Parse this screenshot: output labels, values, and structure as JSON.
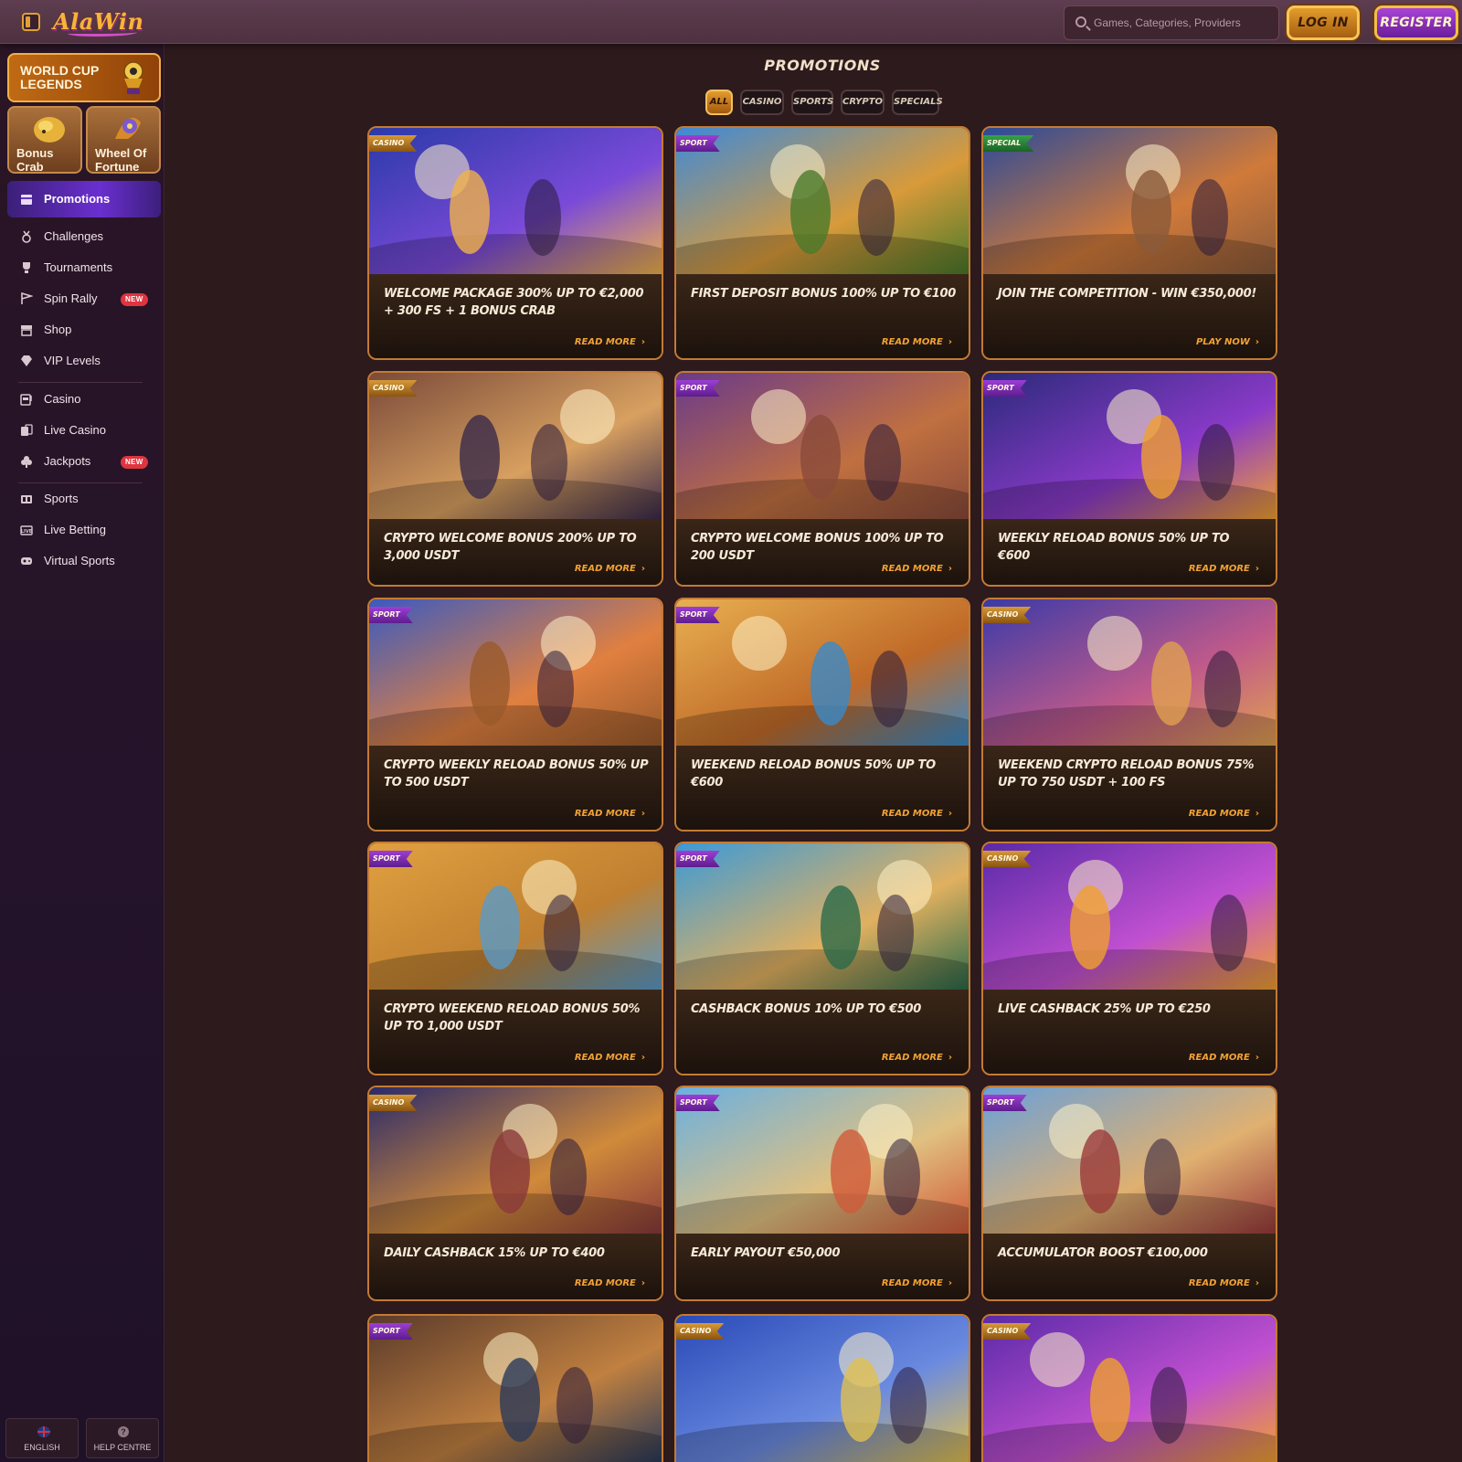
{
  "header": {
    "logo_text": "AlaWin",
    "search_placeholder": "Games, Categories, Providers",
    "login_label": "LOG IN",
    "register_label": "REGISTER"
  },
  "sidebar": {
    "banner_label": "WORLD CUP LEGENDS",
    "tiles": [
      {
        "label_line1": "Bonus",
        "label_line2": "Crab"
      },
      {
        "label_line1": "Wheel Of",
        "label_line2": "Fortune"
      }
    ],
    "items": [
      {
        "label": "Promotions",
        "icon": "gift-box-icon"
      },
      {
        "label": "Challenges",
        "icon": "medal-icon"
      },
      {
        "label": "Tournaments",
        "icon": "trophy-icon"
      },
      {
        "label": "Spin Rally",
        "icon": "flag-race-icon",
        "badge": "NEW"
      },
      {
        "label": "Shop",
        "icon": "store-icon"
      },
      {
        "label": "VIP Levels",
        "icon": "diamond-icon"
      },
      {
        "label": "Casino",
        "icon": "slot-machine-icon"
      },
      {
        "label": "Live Casino",
        "icon": "cards-icon"
      },
      {
        "label": "Jackpots",
        "icon": "clover-icon",
        "badge": "NEW"
      },
      {
        "label": "Sports",
        "icon": "scoreboard-icon"
      },
      {
        "label": "Live Betting",
        "icon": "live-icon"
      },
      {
        "label": "Virtual Sports",
        "icon": "gamepad-icon"
      }
    ],
    "footer": {
      "language": "ENGLISH",
      "help": "HELP CENTRE"
    }
  },
  "main": {
    "title": "PROMOTIONS",
    "filters": [
      "ALL",
      "CASINO",
      "SPORTS",
      "CRYPTO",
      "SPECIALS"
    ],
    "active_filter": "ALL",
    "cards": [
      {
        "tag": "CASINO",
        "title": "WELCOME PACKAGE 300% UP TO €2,000 + 300 FS + 1 BONUS CRAB",
        "cta": "READ MORE"
      },
      {
        "tag": "SPORT",
        "title": "FIRST DEPOSIT BONUS 100% UP TO €100",
        "cta": "READ MORE"
      },
      {
        "tag": "SPECIAL",
        "title": "JOIN THE COMPETITION - WIN €350,000!",
        "cta": "PLAY NOW"
      },
      {
        "tag": "CASINO",
        "title": "CRYPTO WELCOME BONUS 200% UP TO 3,000 USDT",
        "cta": "READ MORE"
      },
      {
        "tag": "SPORT",
        "title": "CRYPTO WELCOME BONUS 100% UP TO 200 USDT",
        "cta": "READ MORE"
      },
      {
        "tag": "SPORT",
        "title": "WEEKLY RELOAD BONUS 50% UP TO €600",
        "cta": "READ MORE"
      },
      {
        "tag": "SPORT",
        "title": "CRYPTO WEEKLY RELOAD BONUS 50% UP TO 500 USDT",
        "cta": "READ MORE"
      },
      {
        "tag": "SPORT",
        "title": "WEEKEND RELOAD BONUS 50% UP TO €600",
        "cta": "READ MORE"
      },
      {
        "tag": "CASINO",
        "title": "WEEKEND CRYPTO RELOAD BONUS 75% UP TO 750 USDT + 100 FS",
        "cta": "READ MORE"
      },
      {
        "tag": "SPORT",
        "title": "CRYPTO WEEKEND RELOAD BONUS 50% UP TO 1,000 USDT",
        "cta": "READ MORE"
      },
      {
        "tag": "SPORT",
        "title": "CASHBACK BONUS 10% UP TO €500",
        "cta": "READ MORE"
      },
      {
        "tag": "CASINO",
        "title": "LIVE CASHBACK 25% UP TO €250",
        "cta": "READ MORE"
      },
      {
        "tag": "CASINO",
        "title": "DAILY CASHBACK 15% UP TO €400",
        "cta": "READ MORE"
      },
      {
        "tag": "SPORT",
        "title": "EARLY PAYOUT €50,000",
        "cta": "READ MORE"
      },
      {
        "tag": "SPORT",
        "title": "ACCUMULATOR BOOST €100,000",
        "cta": "READ MORE"
      },
      {
        "tag": "SPORT",
        "title": "",
        "cta": ""
      },
      {
        "tag": "CASINO",
        "title": "",
        "cta": ""
      },
      {
        "tag": "CASINO",
        "title": "",
        "cta": ""
      }
    ]
  },
  "colors": {
    "accent_orange": "#f2a235",
    "brand_purple": "#7a2fc8",
    "card_border": "#c47a34",
    "badge_red": "#e0343f"
  }
}
